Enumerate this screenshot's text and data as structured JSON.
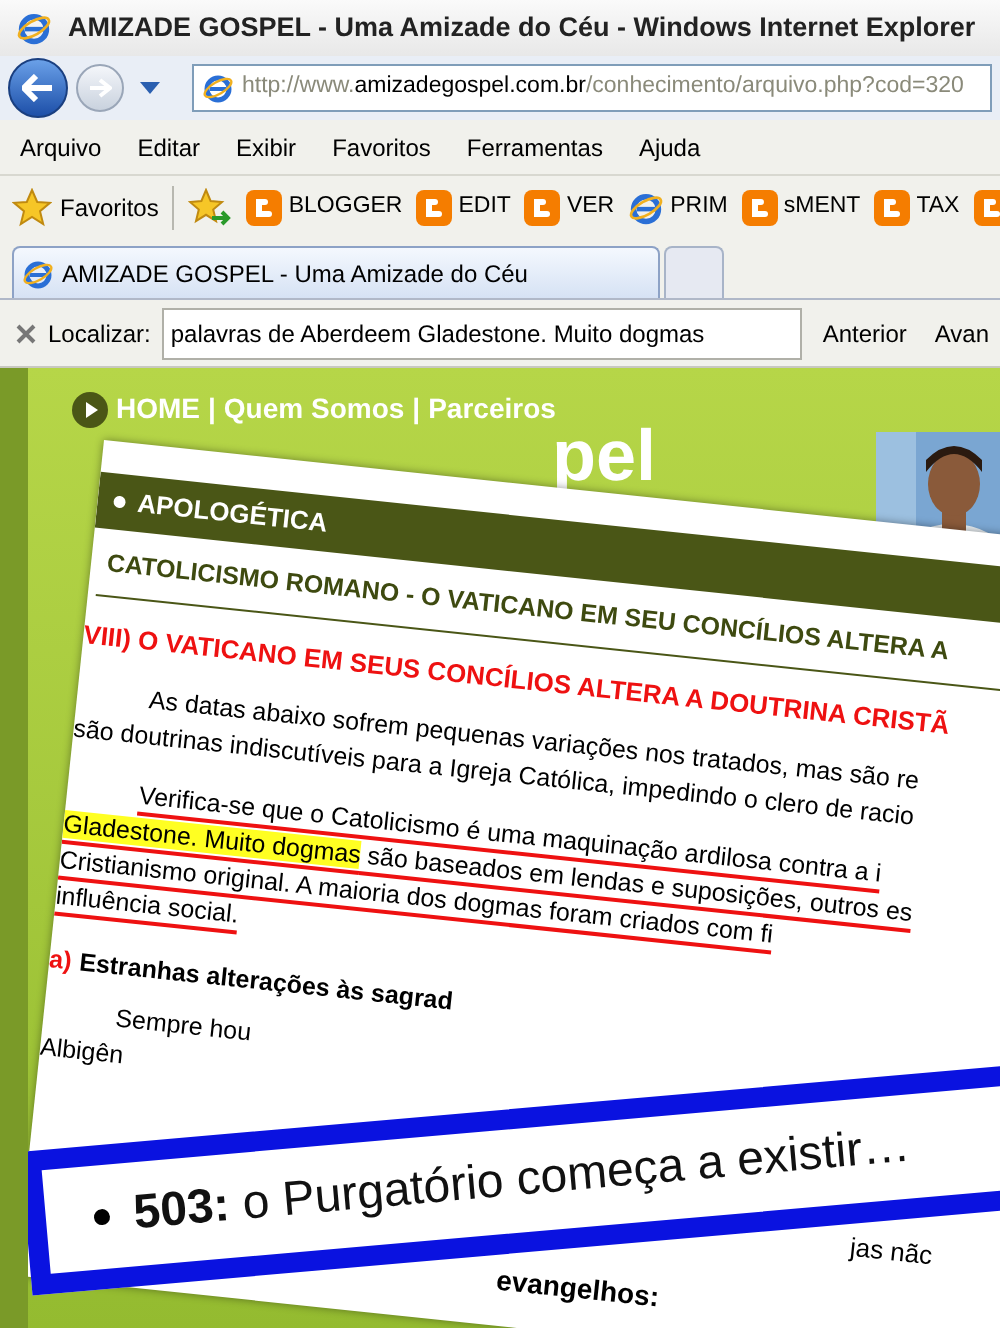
{
  "window": {
    "title": "AMIZADE GOSPEL - Uma Amizade do Céu - Windows Internet Explorer"
  },
  "address_bar": {
    "url_prefix": "http://www.",
    "domain": "amizadegospel.com.br",
    "path": "/conhecimento/arquivo.php?cod=320"
  },
  "menu": [
    "Arquivo",
    "Editar",
    "Exibir",
    "Favoritos",
    "Ferramentas",
    "Ajuda"
  ],
  "favorites_bar": {
    "label": "Favoritos",
    "links": [
      {
        "label": "BLOGGER",
        "kind": "blogger"
      },
      {
        "label": "EDIT",
        "kind": "blogger"
      },
      {
        "label": "VER",
        "kind": "blogger"
      },
      {
        "label": "PRIM",
        "kind": "page"
      },
      {
        "label": "sMENT",
        "kind": "blogger"
      },
      {
        "label": "TAX",
        "kind": "blogger"
      },
      {
        "kind": "blogger"
      }
    ]
  },
  "tabs": [
    {
      "label": "AMIZADE GOSPEL - Uma Amizade do Céu",
      "selected": true
    },
    {
      "kind": "new",
      "selected": false
    }
  ],
  "find_bar": {
    "label": "Localizar:",
    "value": "palavras de Aberdeem Gladestone. Muito dogmas",
    "buttons": [
      "Anterior",
      "Avan"
    ]
  },
  "page": {
    "nav": {
      "items": [
        "HOME",
        "Quem Somos",
        "Parceiros"
      ],
      "separator": "|"
    },
    "logo_fragment": "pel",
    "article": {
      "section": "APOLOGÉTICA",
      "title": "CATOLICISMO ROMANO - O VATICANO EM SEU CONCÍLIOS ALTERA A",
      "heading": "VIII) O VATICANO EM SEUS CONCÍLIOS ALTERA A DOUTRINA CRISTÃ",
      "paragraphs": [
        {
          "underlined": false,
          "lines": [
            [
              {
                "text": "As datas abaixo sofrem pequenas variações nos tratados, mas são re",
                "highlighted": false
              }
            ],
            [
              {
                "text": "são doutrinas indiscutíveis para a Igreja Católica, impedindo o clero de racio",
                "highlighted": false
              }
            ]
          ]
        },
        {
          "underlined": true,
          "lines": [
            [
              {
                "text": "Verifica-se que o Catolicismo é uma maquinação ardilosa contra a i",
                "highlighted": false
              }
            ],
            [
              {
                "text": "Gladestone. Muito dogmas",
                "highlighted": true
              },
              {
                "text": " são baseados em lendas e suposições, outros es",
                "highlighted": false
              }
            ],
            [
              {
                "text": "Cristianismo original. A maioria dos dogmas foram criados com fi",
                "highlighted": false
              }
            ],
            [
              {
                "text": "influência social.",
                "highlighted": false
              }
            ]
          ]
        }
      ],
      "subheading": {
        "marker": "a)",
        "text": "Estranhas alterações às sagrad"
      },
      "fragments": [
        "Sempre hou",
        "Albigên"
      ],
      "lower_fragments": [
        "jas nãc",
        "evangelhos:"
      ]
    },
    "callout": {
      "number": "503:",
      "text": "o Purgatório começa a existir…"
    }
  }
}
